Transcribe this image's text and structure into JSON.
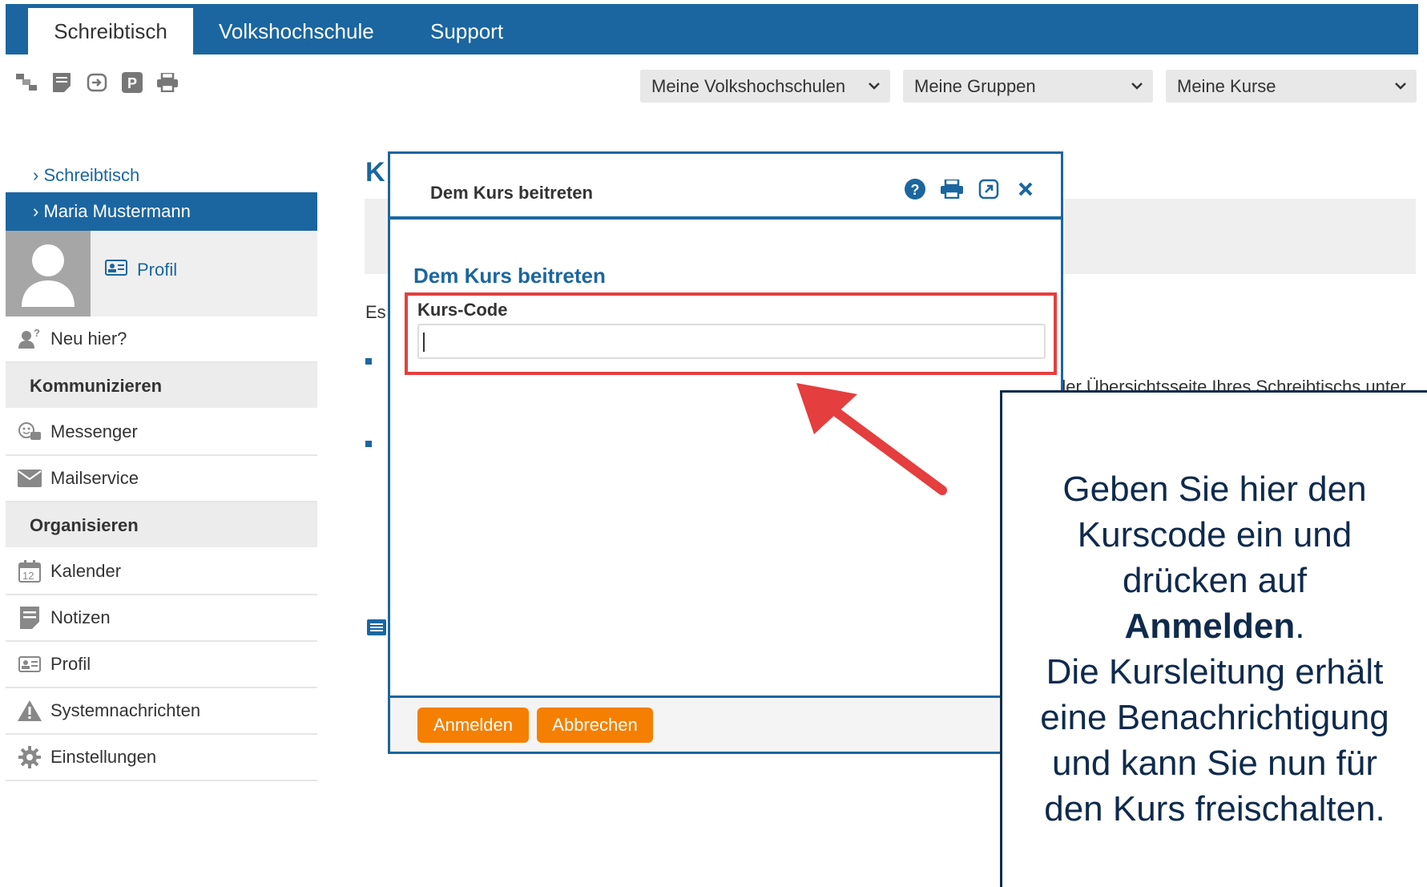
{
  "tabs": [
    "Schreibtisch",
    "Volkshochschule",
    "Support"
  ],
  "toolbar": {
    "icons": [
      "hierarchy-icon",
      "note-icon",
      "login-icon",
      "parking-icon",
      "print-icon"
    ]
  },
  "dropdowns": {
    "vhs": "Meine Volkshochschulen",
    "groups": "Meine Gruppen",
    "courses": "Meine Kurse"
  },
  "sidebar": {
    "breadcrumb": "Schreibtisch",
    "user": "Maria Mustermann",
    "profile_link": "Profil",
    "new_here": "Neu hier?",
    "section_communicate": "Kommunizieren",
    "messenger": "Messenger",
    "mailservice": "Mailservice",
    "section_organize": "Organisieren",
    "calendar": "Kalender",
    "calendar_day": "12",
    "notes": "Notizen",
    "profile": "Profil",
    "system_messages": "Systemnachrichten",
    "settings": "Einstellungen"
  },
  "background": {
    "title_initial": "K",
    "intro_initial": "Es",
    "overview_fragment": "der Übersichtsseite Ihres Schreibtischs unter"
  },
  "modal": {
    "window_title": "Dem Kurs beitreten",
    "heading": "Dem Kurs beitreten",
    "field_label": "Kurs-Code",
    "field_value": "",
    "submit": "Anmelden",
    "cancel": "Abbrechen"
  },
  "callout": {
    "line1": "Geben Sie hier den",
    "line2": "Kurscode ein und",
    "line3": "drücken auf",
    "bold": "Anmelden",
    "period": ".",
    "line5": "Die Kursleitung erhält",
    "line6": "eine Benachrichtigung",
    "line7": "und kann Sie nun für",
    "line8": "den Kurs freischalten."
  },
  "colors": {
    "brand_blue": "#1b66a0",
    "accent_orange": "#f57f00",
    "highlight_red": "#e53e3e",
    "callout_navy": "#0f2a4c"
  }
}
